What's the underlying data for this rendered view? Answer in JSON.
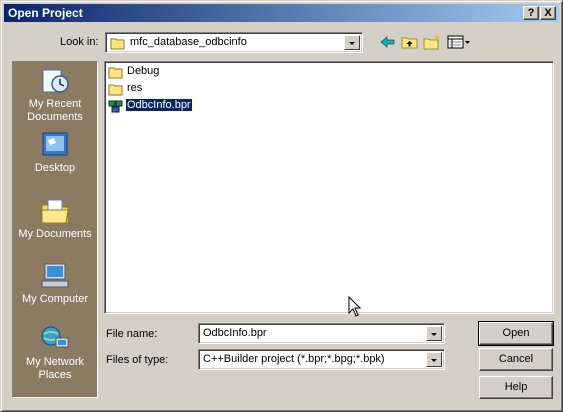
{
  "window": {
    "title": "Open Project",
    "help_label": "?",
    "close_label": "X"
  },
  "look_in": {
    "label": "Look in:",
    "value": "mfc_database_odbcinfo"
  },
  "places": [
    {
      "label": "My Recent Documents",
      "icon": "recent-documents-icon"
    },
    {
      "label": "Desktop",
      "icon": "desktop-icon"
    },
    {
      "label": "My Documents",
      "icon": "my-documents-icon"
    },
    {
      "label": "My Computer",
      "icon": "my-computer-icon"
    },
    {
      "label": "My Network Places",
      "icon": "network-places-icon"
    }
  ],
  "files": [
    {
      "name": "Debug",
      "type": "folder"
    },
    {
      "name": "res",
      "type": "folder"
    },
    {
      "name": "OdbcInfo.bpr",
      "type": "project",
      "selected": true
    }
  ],
  "file_name": {
    "label": "File name:",
    "value": "OdbcInfo.bpr"
  },
  "file_type": {
    "label": "Files of type:",
    "value": "C++Builder project (*.bpr;*.bpg;*.bpk)"
  },
  "buttons": {
    "open": "Open",
    "cancel": "Cancel",
    "help": "Help"
  },
  "colors": {
    "titlebar_start": "#0a246a",
    "titlebar_end": "#a6caf0",
    "places_bar": "#8c7b63",
    "selection": "#0a246a",
    "face": "#d4d0c8"
  }
}
